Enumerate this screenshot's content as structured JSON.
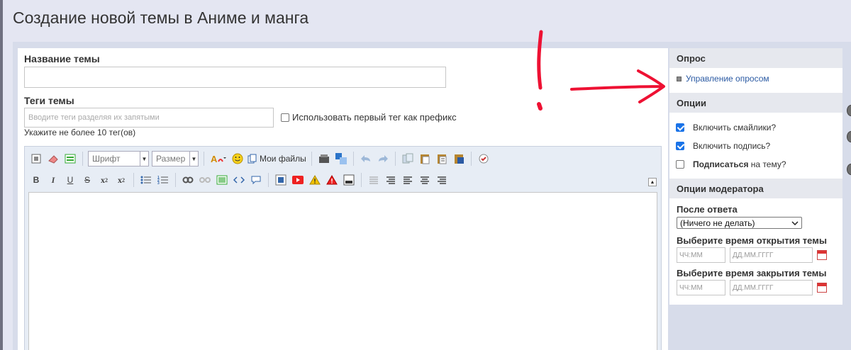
{
  "page": {
    "title": "Создание новой темы в Аниме и манга"
  },
  "form": {
    "topic_name_label": "Название темы",
    "topic_name_value": "",
    "tags_label": "Теги темы",
    "tags_placeholder": "Вводите теги разделяя их запятыми",
    "tags_prefix_checkbox": "Использовать первый тег как префикс",
    "tags_prefix_checked": false,
    "tags_hint": "Укажите не более 10 тег(ов)"
  },
  "editor": {
    "font_select": "Шрифт",
    "size_select": "Размер",
    "my_files_label": "Мои файлы",
    "body_value": ""
  },
  "sidebar": {
    "poll": {
      "title": "Опрос",
      "manage_link": "Управление опросом"
    },
    "options": {
      "title": "Опции",
      "items": [
        {
          "label": "Включить смайлики?",
          "checked": true
        },
        {
          "label": "Включить подпись?",
          "checked": true
        },
        {
          "label_bold": "Подписаться",
          "label_rest": " на тему?",
          "checked": false
        }
      ]
    },
    "moderator": {
      "title": "Опции модератора",
      "after_reply_label": "После ответа",
      "after_reply_value": "(Ничего не делать)",
      "open_time_label": "Выберите время открытия темы",
      "close_time_label": "Выберите время закрытия темы",
      "time_placeholder": "ЧЧ:ММ",
      "date_placeholder": "ДД.ММ.ГГГГ"
    }
  },
  "colors": {
    "accent": "#1a73e8",
    "link": "#2b5aa3",
    "annotation": "#ee1133"
  }
}
